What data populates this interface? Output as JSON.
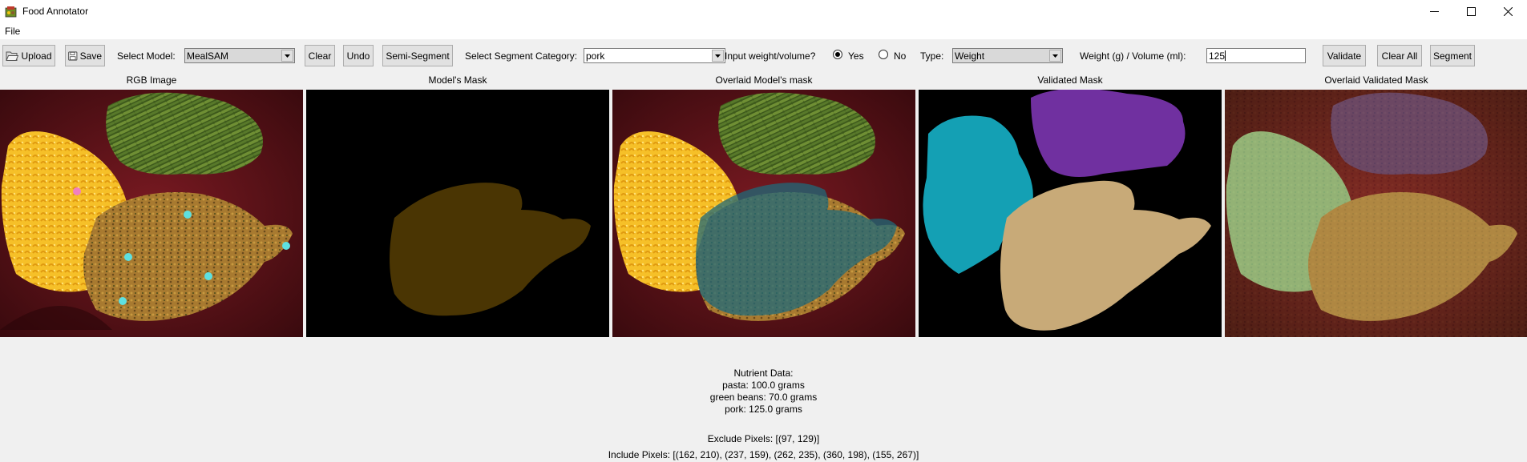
{
  "window": {
    "title": "Food Annotator"
  },
  "menubar": {
    "items": [
      "File"
    ]
  },
  "toolbar": {
    "upload_label": "Upload",
    "save_label": "Save",
    "select_model_label": "Select Model:",
    "model_value": "MealSAM",
    "clear_label": "Clear",
    "undo_label": "Undo",
    "semi_segment_label": "Semi-Segment",
    "segment_category_label": "Select Segment Category:",
    "category_value": "pork",
    "input_weight_label": "Input weight/volume?",
    "yes_label": "Yes",
    "no_label": "No",
    "yes_selected": true,
    "type_label": "Type:",
    "type_value": "Weight",
    "weight_volume_label": "Weight (g) / Volume (ml):",
    "weight_value": "125",
    "validate_label": "Validate",
    "clear_all_label": "Clear All",
    "segment_label": "Segment"
  },
  "panels": {
    "rgb_label": "RGB Image",
    "model_mask_label": "Model's Mask",
    "overlaid_model_label": "Overlaid Model's mask",
    "validated_mask_label": "Validated Mask",
    "overlaid_validated_label": "Overlaid Validated Mask"
  },
  "nutrient": {
    "heading": "Nutrient Data:",
    "lines": [
      "pasta: 100.0 grams",
      "green beans: 70.0 grams",
      "pork: 125.0 grams"
    ]
  },
  "exclude_pixels": "Exclude Pixels: [(97, 129)]",
  "include_pixels": "Include Pixels: [(162, 210), (237, 159), (262, 235), (360, 198), (155, 267)]",
  "colors": {
    "pasta_mask": "#14a0b4",
    "green_beans_mask": "#7030a0",
    "pork_mask": "#c8aa78",
    "model_mask": "#4a3503",
    "include_point": "#5ee0e0",
    "exclude_point": "#f080c0"
  },
  "icons": {
    "app": "food-annotator-icon",
    "upload": "folder-open-icon",
    "save": "floppy-disk-icon",
    "minimize": "minimize-icon",
    "maximize": "maximize-icon",
    "close": "close-icon"
  }
}
